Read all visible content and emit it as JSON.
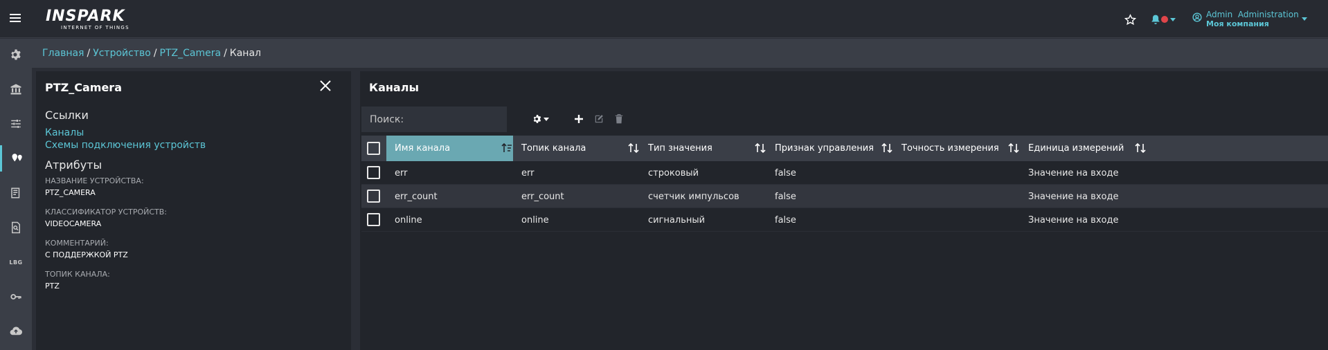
{
  "header": {
    "logo_main": "INSPARK",
    "logo_sub": "INTERNET OF THINGS",
    "user_name": "Admin  Administration",
    "user_company": "Моя компания"
  },
  "sidebar": {
    "items": [
      {
        "icon": "gear-icon"
      },
      {
        "icon": "institution-icon"
      },
      {
        "icon": "sliders-icon"
      },
      {
        "icon": "devices-icon",
        "active": true
      },
      {
        "icon": "dashboard-icon"
      },
      {
        "icon": "report-search-icon"
      },
      {
        "icon": "log-icon",
        "label": "LBG"
      },
      {
        "icon": "key-icon"
      },
      {
        "icon": "cloud-upload-icon"
      }
    ]
  },
  "breadcrumb": {
    "items": [
      "Главная",
      "Устройство",
      "PTZ_Camera"
    ],
    "current": "Канал"
  },
  "device_panel": {
    "title": "PTZ_Camera",
    "links_heading": "Ссылки",
    "links": [
      "Каналы",
      "Схемы подключения устройств"
    ],
    "attributes_heading": "Атрибуты",
    "attributes": [
      {
        "label": "НАЗВАНИЕ УСТРОЙСТВА:",
        "value": "PTZ_CAMERA"
      },
      {
        "label": "КЛАССИФИКАТОР УСТРОЙСТВ:",
        "value": "VIDEOCAMERA"
      },
      {
        "label": "КОММЕНТАРИЙ:",
        "value": "С ПОДДЕРЖКОЙ PTZ"
      },
      {
        "label": "ТОПИК КАНАЛА:",
        "value": "PTZ"
      }
    ]
  },
  "channels_panel": {
    "title": "Каналы",
    "search_placeholder": "Поиск:",
    "columns": [
      "Имя канала",
      "Топик канала",
      "Тип значения",
      "Признак управления",
      "Точность измерения",
      "Единица измерений"
    ],
    "rows": [
      [
        "err",
        "err",
        "строковый",
        "false",
        "",
        "Значение на входе"
      ],
      [
        "err_count",
        "err_count",
        "счетчик импульсов",
        "false",
        "",
        "Значение на входе"
      ],
      [
        "online",
        "online",
        "сигнальный",
        "false",
        "",
        "Значение на входе"
      ]
    ]
  },
  "colors": {
    "accent": "#5cc6d6",
    "sorted_header": "#6aa8b2",
    "notification_dot": "#e0454a"
  }
}
